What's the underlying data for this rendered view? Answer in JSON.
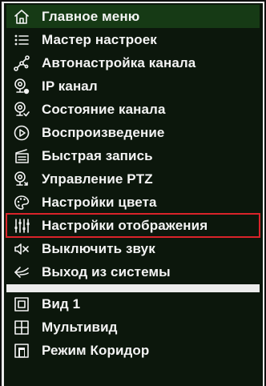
{
  "menu": {
    "items": [
      {
        "label": "Главное меню",
        "icon": "home-icon"
      },
      {
        "label": "Мастер настроек",
        "icon": "list-icon"
      },
      {
        "label": "Автонастройка канала",
        "icon": "nodes-icon"
      },
      {
        "label": "IP канал",
        "icon": "ip-camera-icon"
      },
      {
        "label": "Состояние канала",
        "icon": "camera-status-icon"
      },
      {
        "label": "Воспроизведение",
        "icon": "play-circle-icon"
      },
      {
        "label": "Быстрая запись",
        "icon": "record-icon"
      },
      {
        "label": "Управление PTZ",
        "icon": "ptz-icon"
      },
      {
        "label": "Настройки цвета",
        "icon": "palette-icon"
      },
      {
        "label": "Настройки отображения",
        "icon": "sliders-icon"
      },
      {
        "label": "Выключить звук",
        "icon": "mute-icon"
      },
      {
        "label": "Выход из системы",
        "icon": "logout-icon"
      }
    ],
    "view_items": [
      {
        "label": "Вид 1",
        "icon": "single-view-icon"
      },
      {
        "label": "Мультивид",
        "icon": "multi-view-icon"
      },
      {
        "label": "Режим Коридор",
        "icon": "corridor-view-icon"
      }
    ]
  },
  "colors": {
    "background": "#0c170c",
    "highlight": "#163a15",
    "selection_outline": "#d9232a",
    "text": "#f4f4f4"
  }
}
